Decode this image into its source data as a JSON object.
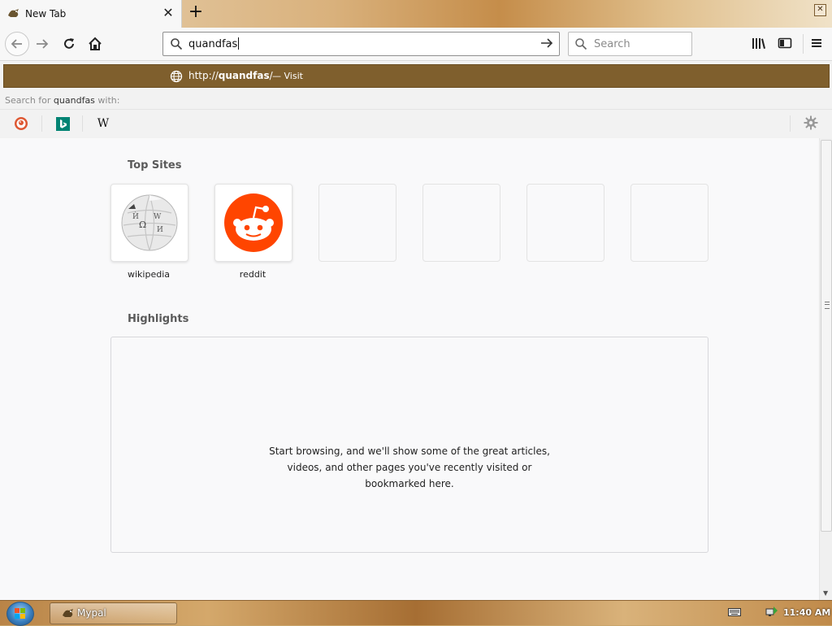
{
  "browser": {
    "tab": {
      "title": "New Tab",
      "icon": "mypal-icon",
      "close_icon": "close-icon"
    },
    "new_tab_icon": "plus-icon",
    "window_close_icon": "close-icon"
  },
  "toolbar": {
    "back_icon": "back-arrow-icon",
    "forward_icon": "forward-arrow-icon",
    "reload_icon": "reload-icon",
    "home_icon": "home-icon",
    "url_value": "quandfas",
    "search_placeholder": "Search",
    "library_icon": "library-icon",
    "sidebar_icon": "sidebar-icon",
    "menu_icon": "hamburger-menu-icon"
  },
  "autocomplete": {
    "suggestion_prefix": "http://",
    "suggestion_host": "quandfas",
    "suggestion_suffix": "/",
    "suggestion_action": "— Visit",
    "search_with_prefix": "Search for",
    "search_with_term": "quandfas",
    "search_with_suffix": "with:",
    "engines": [
      "duckduckgo-icon",
      "bing-icon",
      "wikipedia-icon"
    ],
    "wikipedia_glyph": "W"
  },
  "newtab": {
    "top_sites_title": "Top Sites",
    "top_sites": [
      {
        "label": "wikipedia"
      },
      {
        "label": "reddit"
      },
      {
        "label": ""
      },
      {
        "label": ""
      },
      {
        "label": ""
      },
      {
        "label": ""
      }
    ],
    "highlights_title": "Highlights",
    "highlights_empty_line1": "Start browsing, and we'll show some of the great articles,",
    "highlights_empty_line2": "videos, and other pages you've recently visited or",
    "highlights_empty_line3": "bookmarked here."
  },
  "taskbar": {
    "app_label": "Mypal",
    "clock": "11:40 AM"
  },
  "colors": {
    "accent_suggestion": "#7f5f2d",
    "reddit": "#ff4500"
  }
}
